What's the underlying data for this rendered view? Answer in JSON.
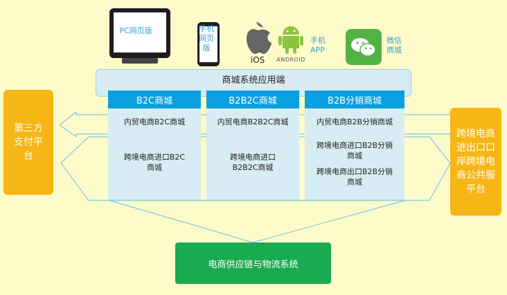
{
  "devices": {
    "pc_label": "PC网页版",
    "phone_label": "手机网页版",
    "ios_label": "iOS",
    "android_label": "ANDROID",
    "app_label": "手机APP",
    "wechat_label": "微信商城"
  },
  "app_system": "商城系统应用端",
  "left_platform": "第三方支付平台",
  "right_platform": "跨境电商进出口口岸跨境电商公共服平台",
  "columns": [
    {
      "header": "B2C商城",
      "domestic": "内贸电商B2C商城",
      "crossborder": "跨境电商进口B2C商城"
    },
    {
      "header": "B2B2C商城",
      "domestic": "内贸电商B2B2C商城",
      "crossborder": "跨境电商进口B2B2C商城"
    },
    {
      "header": "B2B分销商城",
      "domestic": "内贸电商B2B分销商城",
      "crossborder": "跨境电商进口B2B分销商城",
      "crossborder_export": "跨境电商出口B2B分销商城"
    }
  ],
  "bottom": "电商供应链与物流系统",
  "colors": {
    "accent_blue": "#0aa0e0",
    "orange": "#f6b616",
    "green": "#1aaa50",
    "background": "#fdfbc9"
  }
}
